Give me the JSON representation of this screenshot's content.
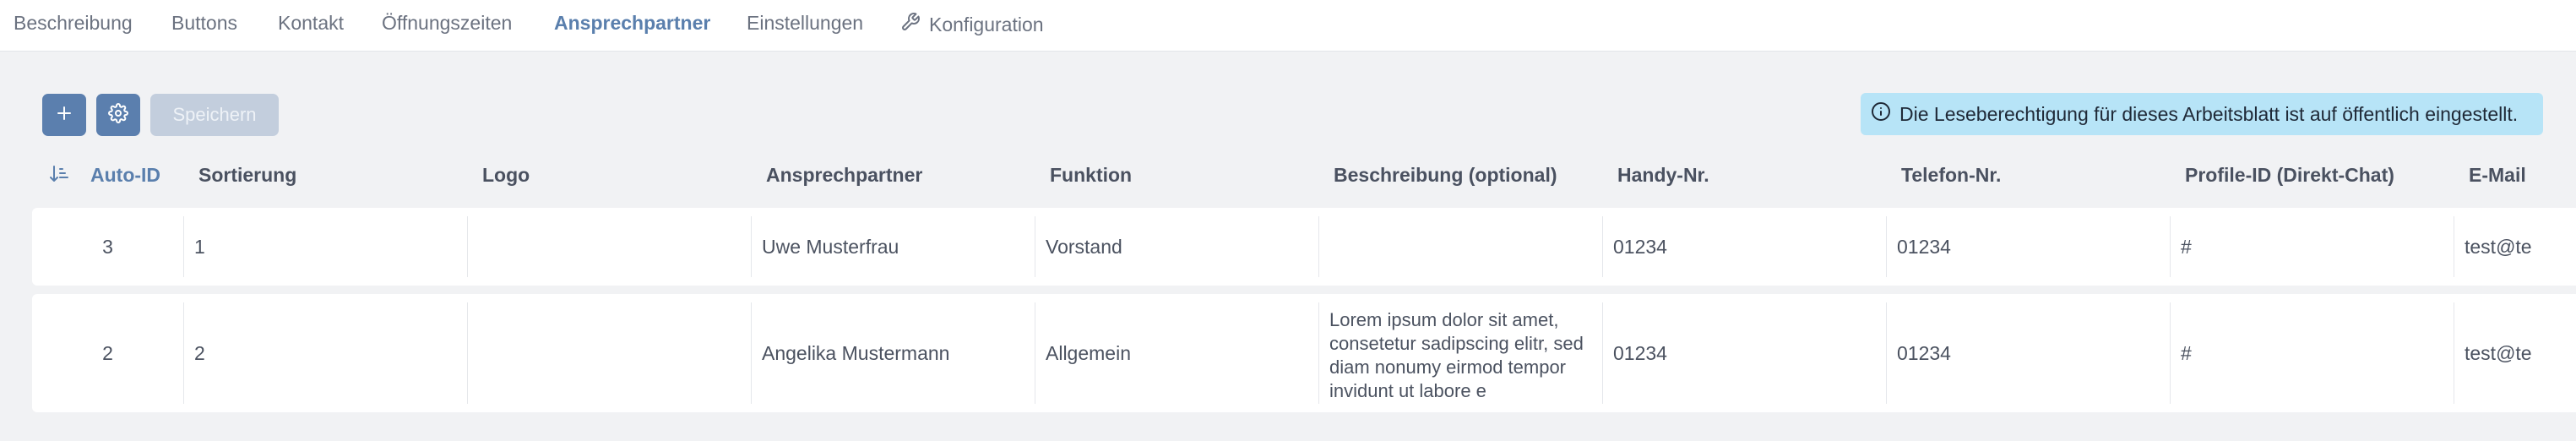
{
  "tabs": [
    {
      "label": "Beschreibung"
    },
    {
      "label": "Buttons"
    },
    {
      "label": "Kontakt"
    },
    {
      "label": "Öffnungszeiten"
    },
    {
      "label": "Ansprechpartner",
      "active": true
    },
    {
      "label": "Einstellungen"
    },
    {
      "label": "Konfiguration",
      "icon": "wrench-icon"
    }
  ],
  "toolbar": {
    "add_icon": "plus-icon",
    "settings_icon": "gear-icon",
    "save_label": "Speichern"
  },
  "info_banner": {
    "icon": "info-circle-icon",
    "text": "Die Leseberechtigung für dieses Arbeitsblatt ist auf öffentlich eingestellt."
  },
  "table": {
    "sort_icon": "sort-ascending-icon",
    "columns": [
      "Auto-ID",
      "Sortierung",
      "Logo",
      "Ansprechpartner",
      "Funktion",
      "Beschreibung (optional)",
      "Handy-Nr.",
      "Telefon-Nr.",
      "Profile-ID (Direkt-Chat)",
      "E-Mail"
    ],
    "rows": [
      {
        "auto_id": "3",
        "sortierung": "1",
        "logo": "",
        "ansprechpartner": "Uwe Musterfrau",
        "funktion": "Vorstand",
        "beschreibung": "",
        "handy": "01234",
        "telefon": "01234",
        "profile_id": "#",
        "email": "test@te"
      },
      {
        "auto_id": "2",
        "sortierung": "2",
        "logo": "",
        "ansprechpartner": "Angelika Mustermann",
        "funktion": "Allgemein",
        "beschreibung": "Lorem ipsum dolor sit amet, consetetur sadipscing elitr, sed diam nonumy eirmod tempor invidunt ut labore e",
        "handy": "01234",
        "telefon": "01234",
        "profile_id": "#",
        "email": "test@te"
      }
    ]
  },
  "colors": {
    "accent": "#5b7fae",
    "page_bg": "#f1f2f4",
    "banner_bg": "#b7e4f7",
    "disabled_button": "#c3cedd"
  }
}
